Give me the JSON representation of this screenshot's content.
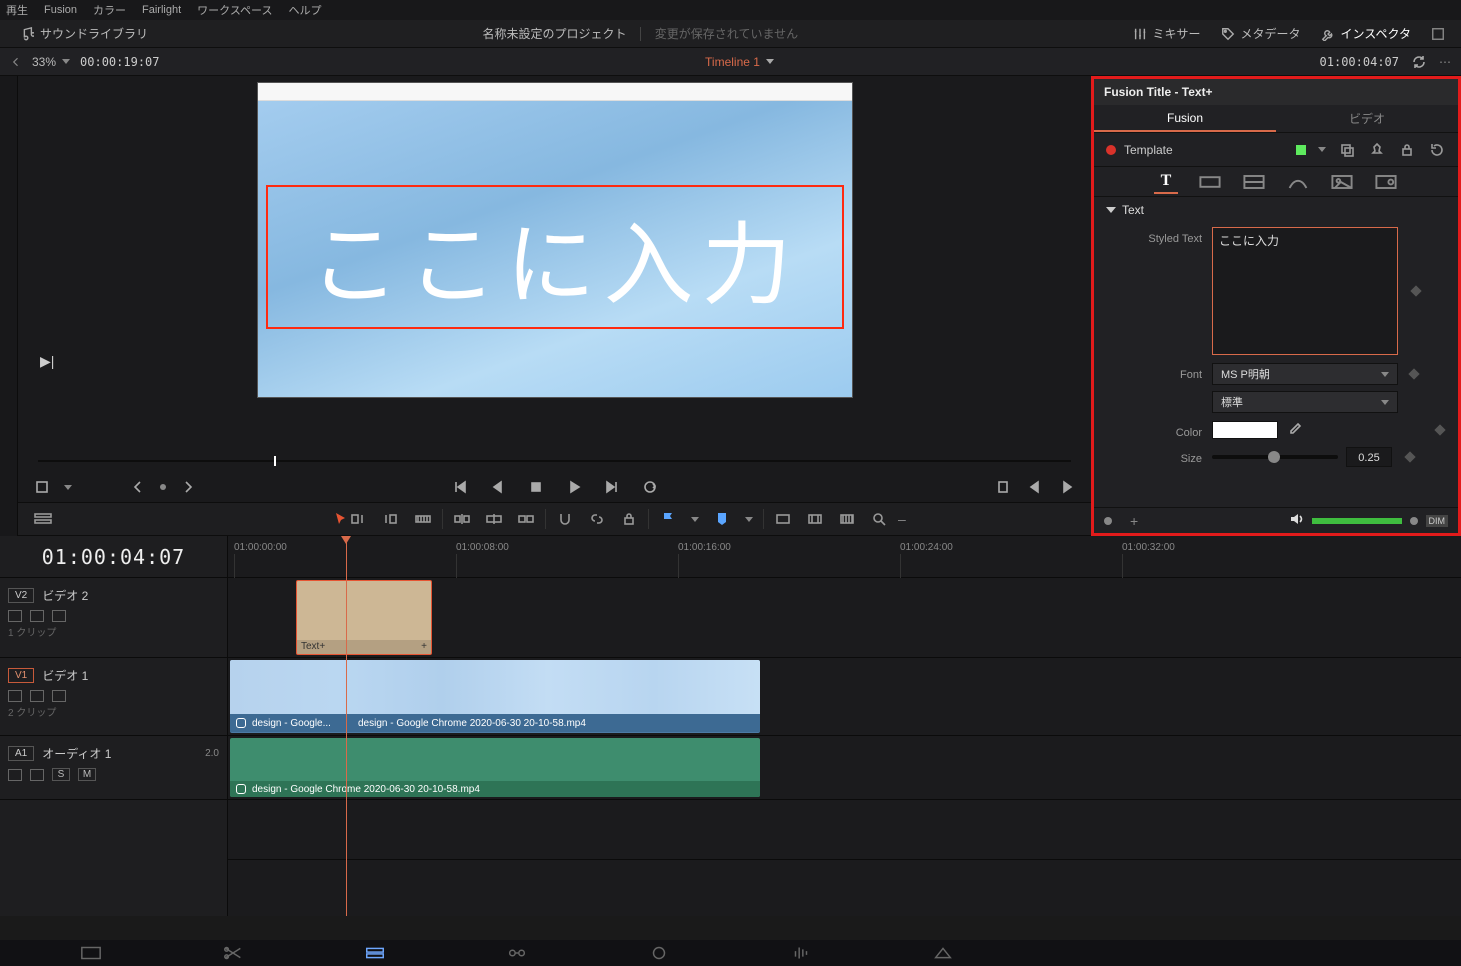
{
  "menu": [
    "再生",
    "Fusion",
    "カラー",
    "Fairlight",
    "ワークスペース",
    "ヘルプ"
  ],
  "uibar": {
    "sound_lib": "サウンドライブラリ",
    "project": "名称未設定のプロジェクト",
    "unsaved": "変更が保存されていません",
    "mixer": "ミキサー",
    "metadata": "メタデータ",
    "inspector": "インスペクタ"
  },
  "viewer": {
    "zoom": "33%",
    "tc_left": "00:00:19:07",
    "timeline_name": "Timeline 1",
    "tc_right": "01:00:04:07",
    "overlay_text": "ここに入力"
  },
  "inspector_panel": {
    "title": "Fusion Title - Text+",
    "tabs": {
      "fusion": "Fusion",
      "video": "ビデオ"
    },
    "template": "Template",
    "section": "Text",
    "labels": {
      "styled": "Styled Text",
      "font": "Font",
      "color": "Color",
      "size": "Size"
    },
    "styled_text": "ここに入力",
    "font": "MS P明朝",
    "font_style": "標準",
    "color": "#ffffff",
    "size": "0.25",
    "dim": "DIM"
  },
  "timeline": {
    "current_tc": "01:00:04:07",
    "ticks": [
      "01:00:00:00",
      "01:00:08:00",
      "01:00:16:00",
      "01:00:24:00",
      "01:00:32:00"
    ],
    "tracks": {
      "v2": {
        "badge": "V2",
        "name": "ビデオ 2",
        "clips": "1 クリップ",
        "clip_label": "Text+"
      },
      "v1": {
        "badge": "V1",
        "name": "ビデオ 1",
        "clips": "2 クリップ",
        "clip_label_short": "design - Google...",
        "clip_label": "design - Google Chrome 2020-06-30 20-10-58.mp4"
      },
      "a1": {
        "badge": "A1",
        "name": "オーディオ 1",
        "level": "2.0",
        "clip_label": "design - Google Chrome 2020-06-30 20-10-58.mp4"
      }
    }
  }
}
